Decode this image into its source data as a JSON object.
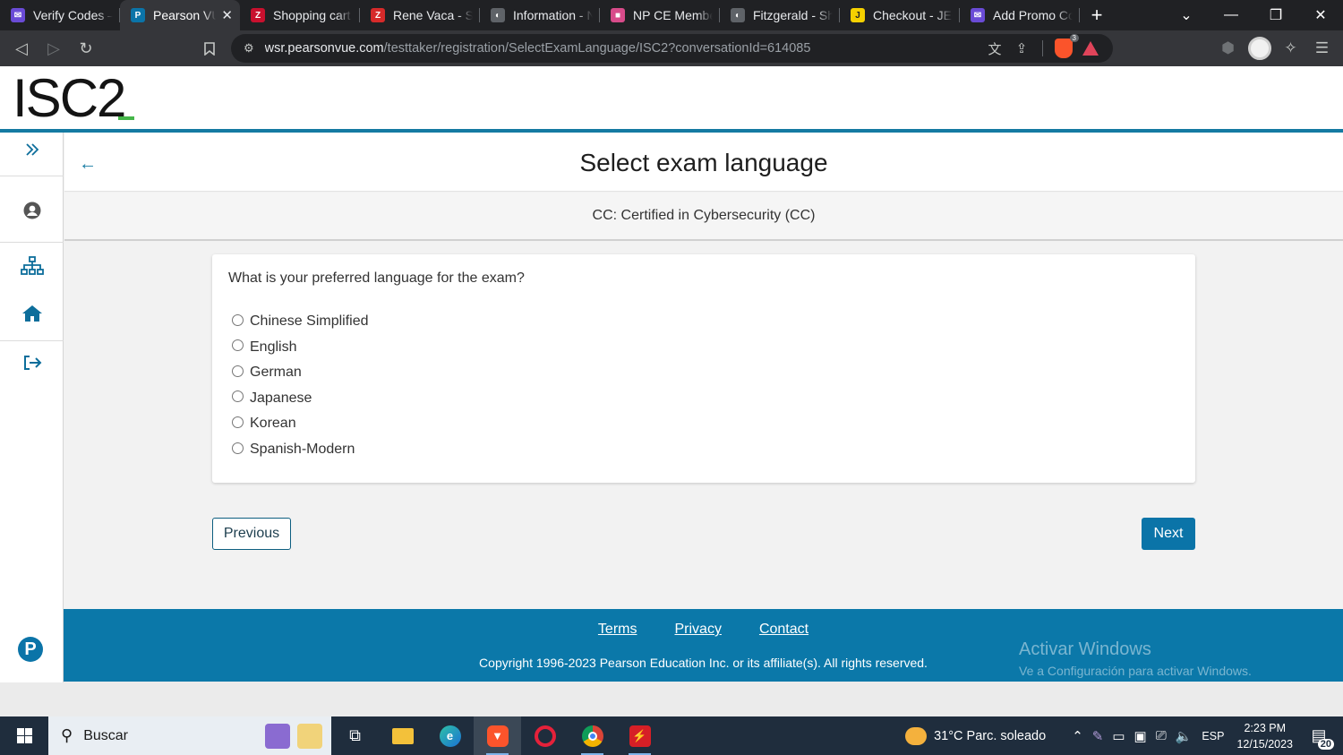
{
  "browser": {
    "tabs": [
      {
        "title": "Verify Codes — ",
        "favicon_color": "#6a4bd6",
        "glyph": "✉"
      },
      {
        "title": "Pearson VU",
        "favicon_color": "#0b74a8",
        "glyph": "P",
        "active": true
      },
      {
        "title": "Shopping cart | ",
        "favicon_color": "#c8102e",
        "glyph": "Z"
      },
      {
        "title": "Rene Vaca - Spe",
        "favicon_color": "#d62a2a",
        "glyph": "Z"
      },
      {
        "title": "Information - N",
        "favicon_color": "#5f6368",
        "glyph": "◐"
      },
      {
        "title": "NP CE Members",
        "favicon_color": "#d84b8a",
        "glyph": "■"
      },
      {
        "title": "Fitzgerald - Sho",
        "favicon_color": "#5f6368",
        "glyph": "◐"
      },
      {
        "title": "Checkout - JEGS",
        "favicon_color": "#f5d000",
        "glyph": "J"
      },
      {
        "title": "Add Promo Coc",
        "favicon_color": "#6a4bd6",
        "glyph": "✉"
      }
    ],
    "tab_close": "✕",
    "new_tab": "+",
    "url_host": "wsr.pearsonvue.com",
    "url_path": "/testtaker/registration/SelectExamLanguage/ISC2?conversationId=614085",
    "brave_badge": "3"
  },
  "header": {
    "logo_text": "ISC2"
  },
  "page": {
    "title": "Select exam language",
    "exam_name": "CC: Certified in Cybersecurity (CC)",
    "question": "What is your preferred language for the exam?",
    "options": [
      "Chinese Simplified",
      "English",
      "German",
      "Japanese",
      "Korean",
      "Spanish-Modern"
    ],
    "selected_option": null,
    "previous_label": "Previous",
    "next_label": "Next"
  },
  "footer": {
    "terms": "Terms",
    "privacy": "Privacy",
    "contact": "Contact",
    "copyright": "Copyright 1996-2023 Pearson Education Inc. or its affiliate(s). All rights reserved."
  },
  "watermark": {
    "line1": "Activar Windows",
    "line2": "Ve a Configuración para activar Windows."
  },
  "taskbar": {
    "search_placeholder": "Buscar",
    "weather": "31°C  Parc. soleado",
    "language": "ESP",
    "time": "2:23 PM",
    "date": "12/15/2023",
    "notifications": "20"
  },
  "colors": {
    "accent": "#0b74a8",
    "header_rule": "#147aa2",
    "footer_bg": "#0b78a9",
    "logo_green": "#45b649"
  }
}
